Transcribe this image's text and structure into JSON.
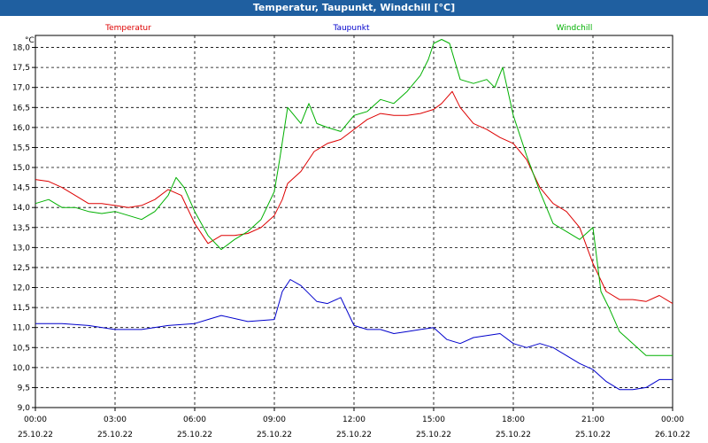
{
  "window": {
    "title": "Temperatur, Taupunkt, Windchill [°C]"
  },
  "chart_data": {
    "type": "line",
    "title": "Temperatur, Taupunkt, Windchill [°C]",
    "ylabel": "°C",
    "ylim": [
      9.0,
      18.3
    ],
    "xlim": [
      0,
      24
    ],
    "grid": true,
    "legend": "top",
    "yticks": [
      9.0,
      9.5,
      10.0,
      10.5,
      11.0,
      11.5,
      12.0,
      12.5,
      13.0,
      13.5,
      14.0,
      14.5,
      15.0,
      15.5,
      16.0,
      16.5,
      17.0,
      17.5,
      18.0
    ],
    "ytick_labels": [
      "9,0",
      "9,5",
      "10,0",
      "10,5",
      "11,0",
      "11,5",
      "12,0",
      "12,5",
      "13,0",
      "13,5",
      "14,0",
      "14,5",
      "15,0",
      "15,5",
      "16,0",
      "16,5",
      "17,0",
      "17,5",
      "18,0"
    ],
    "xticks": [
      0,
      3,
      6,
      9,
      12,
      15,
      18,
      21,
      24
    ],
    "xtick_times": [
      "00:00",
      "03:00",
      "06:00",
      "09:00",
      "12:00",
      "15:00",
      "18:00",
      "21:00",
      "00:00"
    ],
    "xtick_dates": [
      "25.10.22",
      "25.10.22",
      "25.10.22",
      "25.10.22",
      "25.10.22",
      "25.10.22",
      "25.10.22",
      "25.10.22",
      "26.10.22"
    ],
    "series": [
      {
        "name": "Temperatur",
        "color": "#dd0000",
        "x": [
          0,
          0.5,
          1,
          1.5,
          2,
          2.5,
          3,
          3.5,
          4,
          4.5,
          5,
          5.5,
          6,
          6.3,
          6.5,
          7,
          7.5,
          8,
          8.5,
          9,
          9.3,
          9.5,
          10,
          10.5,
          11,
          11.5,
          12,
          12.5,
          13,
          13.5,
          14,
          14.5,
          15,
          15.3,
          15.7,
          16,
          16.5,
          17,
          17.5,
          18,
          18.5,
          19,
          19.5,
          20,
          20.5,
          21,
          21.5,
          22,
          22.5,
          23,
          23.5,
          24
        ],
        "values": [
          14.7,
          14.65,
          14.5,
          14.3,
          14.1,
          14.1,
          14.05,
          14.0,
          14.05,
          14.2,
          14.45,
          14.3,
          13.6,
          13.3,
          13.1,
          13.3,
          13.3,
          13.35,
          13.5,
          13.8,
          14.2,
          14.6,
          14.9,
          15.4,
          15.6,
          15.7,
          15.95,
          16.2,
          16.35,
          16.3,
          16.3,
          16.35,
          16.45,
          16.6,
          16.9,
          16.5,
          16.1,
          15.95,
          15.75,
          15.6,
          15.2,
          14.5,
          14.1,
          13.9,
          13.5,
          12.6,
          11.9,
          11.7,
          11.7,
          11.65,
          11.8,
          11.6
        ]
      },
      {
        "name": "Taupunkt",
        "color": "#0000cc",
        "x": [
          0,
          1,
          2,
          3,
          4,
          5,
          6,
          6.5,
          7,
          8,
          9,
          9.3,
          9.6,
          10,
          10.3,
          10.6,
          11,
          11.5,
          12,
          12.5,
          13,
          13.5,
          14,
          14.5,
          15,
          15.5,
          16,
          16.5,
          17,
          17.5,
          18,
          18.5,
          19,
          19.5,
          20,
          20.5,
          21,
          21.5,
          22,
          22.5,
          23,
          23.5,
          24
        ],
        "values": [
          11.1,
          11.1,
          11.05,
          10.95,
          10.95,
          11.05,
          11.1,
          11.2,
          11.3,
          11.15,
          11.2,
          11.9,
          12.2,
          12.05,
          11.85,
          11.65,
          11.6,
          11.75,
          11.05,
          10.95,
          10.95,
          10.85,
          10.9,
          10.95,
          11.0,
          10.7,
          10.6,
          10.75,
          10.8,
          10.85,
          10.6,
          10.5,
          10.6,
          10.5,
          10.3,
          10.1,
          9.95,
          9.65,
          9.45,
          9.45,
          9.5,
          9.7,
          9.7
        ]
      },
      {
        "name": "Windchill",
        "color": "#00b000",
        "x": [
          0,
          0.5,
          1,
          1.5,
          2,
          2.5,
          3,
          3.5,
          4,
          4.5,
          5,
          5.3,
          5.6,
          6,
          6.5,
          7,
          7.5,
          8,
          8.5,
          9,
          9.2,
          9.5,
          10,
          10.3,
          10.6,
          11,
          11.5,
          12,
          12.5,
          13,
          13.5,
          14,
          14.5,
          14.8,
          15,
          15.3,
          15.6,
          16,
          16.5,
          17,
          17.3,
          17.6,
          18,
          18.5,
          19,
          19.5,
          20,
          20.5,
          21,
          21.3,
          21.6,
          22,
          22.5,
          23,
          23.5,
          24
        ],
        "values": [
          14.1,
          14.2,
          14.0,
          14.0,
          13.9,
          13.85,
          13.9,
          13.8,
          13.7,
          13.9,
          14.3,
          14.75,
          14.5,
          13.9,
          13.3,
          12.95,
          13.2,
          13.4,
          13.7,
          14.4,
          15.2,
          16.5,
          16.1,
          16.6,
          16.1,
          16.0,
          15.9,
          16.3,
          16.4,
          16.7,
          16.6,
          16.9,
          17.3,
          17.7,
          18.1,
          18.2,
          18.1,
          17.2,
          17.1,
          17.2,
          17.0,
          17.5,
          16.3,
          15.3,
          14.4,
          13.6,
          13.4,
          13.2,
          13.5,
          11.9,
          11.5,
          10.9,
          10.6,
          10.3,
          10.3,
          10.3
        ]
      }
    ]
  }
}
